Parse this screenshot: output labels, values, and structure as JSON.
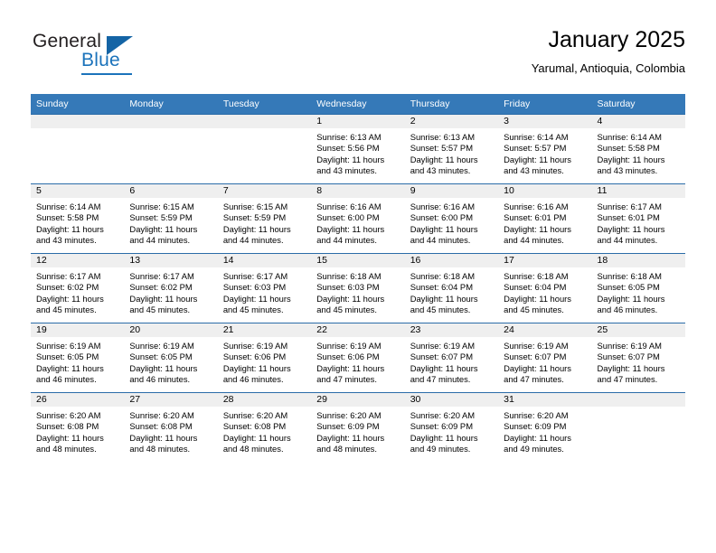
{
  "logo": {
    "word1": "General",
    "word2": "Blue",
    "icon": "triangle-logo-mark"
  },
  "header": {
    "title": "January 2025",
    "subtitle": "Yarumal, Antioquia, Colombia"
  },
  "colors": {
    "header_blue": "#3579b8",
    "row_border_blue": "#2b6ca8",
    "daynum_strip": "#efefef",
    "logo_blue": "#1b73bb"
  },
  "weekday_headers": [
    "Sunday",
    "Monday",
    "Tuesday",
    "Wednesday",
    "Thursday",
    "Friday",
    "Saturday"
  ],
  "weeks": [
    [
      {
        "day": "",
        "lines": []
      },
      {
        "day": "",
        "lines": []
      },
      {
        "day": "",
        "lines": []
      },
      {
        "day": "1",
        "lines": [
          "Sunrise: 6:13 AM",
          "Sunset: 5:56 PM",
          "Daylight: 11 hours",
          "and 43 minutes."
        ]
      },
      {
        "day": "2",
        "lines": [
          "Sunrise: 6:13 AM",
          "Sunset: 5:57 PM",
          "Daylight: 11 hours",
          "and 43 minutes."
        ]
      },
      {
        "day": "3",
        "lines": [
          "Sunrise: 6:14 AM",
          "Sunset: 5:57 PM",
          "Daylight: 11 hours",
          "and 43 minutes."
        ]
      },
      {
        "day": "4",
        "lines": [
          "Sunrise: 6:14 AM",
          "Sunset: 5:58 PM",
          "Daylight: 11 hours",
          "and 43 minutes."
        ]
      }
    ],
    [
      {
        "day": "5",
        "lines": [
          "Sunrise: 6:14 AM",
          "Sunset: 5:58 PM",
          "Daylight: 11 hours",
          "and 43 minutes."
        ]
      },
      {
        "day": "6",
        "lines": [
          "Sunrise: 6:15 AM",
          "Sunset: 5:59 PM",
          "Daylight: 11 hours",
          "and 44 minutes."
        ]
      },
      {
        "day": "7",
        "lines": [
          "Sunrise: 6:15 AM",
          "Sunset: 5:59 PM",
          "Daylight: 11 hours",
          "and 44 minutes."
        ]
      },
      {
        "day": "8",
        "lines": [
          "Sunrise: 6:16 AM",
          "Sunset: 6:00 PM",
          "Daylight: 11 hours",
          "and 44 minutes."
        ]
      },
      {
        "day": "9",
        "lines": [
          "Sunrise: 6:16 AM",
          "Sunset: 6:00 PM",
          "Daylight: 11 hours",
          "and 44 minutes."
        ]
      },
      {
        "day": "10",
        "lines": [
          "Sunrise: 6:16 AM",
          "Sunset: 6:01 PM",
          "Daylight: 11 hours",
          "and 44 minutes."
        ]
      },
      {
        "day": "11",
        "lines": [
          "Sunrise: 6:17 AM",
          "Sunset: 6:01 PM",
          "Daylight: 11 hours",
          "and 44 minutes."
        ]
      }
    ],
    [
      {
        "day": "12",
        "lines": [
          "Sunrise: 6:17 AM",
          "Sunset: 6:02 PM",
          "Daylight: 11 hours",
          "and 45 minutes."
        ]
      },
      {
        "day": "13",
        "lines": [
          "Sunrise: 6:17 AM",
          "Sunset: 6:02 PM",
          "Daylight: 11 hours",
          "and 45 minutes."
        ]
      },
      {
        "day": "14",
        "lines": [
          "Sunrise: 6:17 AM",
          "Sunset: 6:03 PM",
          "Daylight: 11 hours",
          "and 45 minutes."
        ]
      },
      {
        "day": "15",
        "lines": [
          "Sunrise: 6:18 AM",
          "Sunset: 6:03 PM",
          "Daylight: 11 hours",
          "and 45 minutes."
        ]
      },
      {
        "day": "16",
        "lines": [
          "Sunrise: 6:18 AM",
          "Sunset: 6:04 PM",
          "Daylight: 11 hours",
          "and 45 minutes."
        ]
      },
      {
        "day": "17",
        "lines": [
          "Sunrise: 6:18 AM",
          "Sunset: 6:04 PM",
          "Daylight: 11 hours",
          "and 45 minutes."
        ]
      },
      {
        "day": "18",
        "lines": [
          "Sunrise: 6:18 AM",
          "Sunset: 6:05 PM",
          "Daylight: 11 hours",
          "and 46 minutes."
        ]
      }
    ],
    [
      {
        "day": "19",
        "lines": [
          "Sunrise: 6:19 AM",
          "Sunset: 6:05 PM",
          "Daylight: 11 hours",
          "and 46 minutes."
        ]
      },
      {
        "day": "20",
        "lines": [
          "Sunrise: 6:19 AM",
          "Sunset: 6:05 PM",
          "Daylight: 11 hours",
          "and 46 minutes."
        ]
      },
      {
        "day": "21",
        "lines": [
          "Sunrise: 6:19 AM",
          "Sunset: 6:06 PM",
          "Daylight: 11 hours",
          "and 46 minutes."
        ]
      },
      {
        "day": "22",
        "lines": [
          "Sunrise: 6:19 AM",
          "Sunset: 6:06 PM",
          "Daylight: 11 hours",
          "and 47 minutes."
        ]
      },
      {
        "day": "23",
        "lines": [
          "Sunrise: 6:19 AM",
          "Sunset: 6:07 PM",
          "Daylight: 11 hours",
          "and 47 minutes."
        ]
      },
      {
        "day": "24",
        "lines": [
          "Sunrise: 6:19 AM",
          "Sunset: 6:07 PM",
          "Daylight: 11 hours",
          "and 47 minutes."
        ]
      },
      {
        "day": "25",
        "lines": [
          "Sunrise: 6:19 AM",
          "Sunset: 6:07 PM",
          "Daylight: 11 hours",
          "and 47 minutes."
        ]
      }
    ],
    [
      {
        "day": "26",
        "lines": [
          "Sunrise: 6:20 AM",
          "Sunset: 6:08 PM",
          "Daylight: 11 hours",
          "and 48 minutes."
        ]
      },
      {
        "day": "27",
        "lines": [
          "Sunrise: 6:20 AM",
          "Sunset: 6:08 PM",
          "Daylight: 11 hours",
          "and 48 minutes."
        ]
      },
      {
        "day": "28",
        "lines": [
          "Sunrise: 6:20 AM",
          "Sunset: 6:08 PM",
          "Daylight: 11 hours",
          "and 48 minutes."
        ]
      },
      {
        "day": "29",
        "lines": [
          "Sunrise: 6:20 AM",
          "Sunset: 6:09 PM",
          "Daylight: 11 hours",
          "and 48 minutes."
        ]
      },
      {
        "day": "30",
        "lines": [
          "Sunrise: 6:20 AM",
          "Sunset: 6:09 PM",
          "Daylight: 11 hours",
          "and 49 minutes."
        ]
      },
      {
        "day": "31",
        "lines": [
          "Sunrise: 6:20 AM",
          "Sunset: 6:09 PM",
          "Daylight: 11 hours",
          "and 49 minutes."
        ]
      },
      {
        "day": "",
        "lines": []
      }
    ]
  ]
}
